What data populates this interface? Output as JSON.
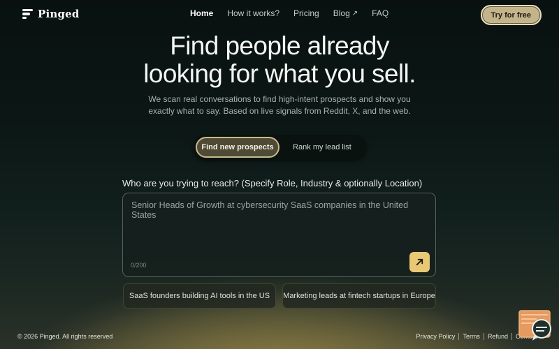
{
  "nav": {
    "brand": "Pinged",
    "links": [
      {
        "label": "Home",
        "active": true
      },
      {
        "label": "How it works?",
        "active": false
      },
      {
        "label": "Pricing",
        "active": false
      },
      {
        "label": "Blog",
        "external_icon": "arrow-up-right-icon",
        "active": false
      },
      {
        "label": "FAQ",
        "active": false
      }
    ],
    "cta_label": "Try for free"
  },
  "hero": {
    "title_line1": "Find people already",
    "title_line2": "looking for what you sell.",
    "subtitle_line1": "We scan real conversations to find high-intent prospects and show you",
    "subtitle_line2": "exactly what to say. Based on live signals from Reddit, X, and the web."
  },
  "mode_toggle": {
    "options": [
      "Find new prospects",
      "Rank my lead list"
    ],
    "selected": "Find new prospects"
  },
  "prompt": {
    "label": "Who are you trying to reach? (Specify Role, Industry & optionally Location)",
    "placeholder": "Senior Heads of Growth at cybersecurity SaaS companies in the United States",
    "value": "",
    "counter": "0/200",
    "submit_icon": "arrow-up-right-icon"
  },
  "suggestions": [
    "SaaS founders building AI tools in the US",
    "Marketing leads at fintech startups in Europe"
  ],
  "footer": {
    "copyright": "© 2026 Pinged. All rights reserved",
    "links": [
      "Privacy Policy",
      "Terms",
      "Refund",
      "Contact"
    ]
  },
  "colors": {
    "accent": "#e8c870",
    "cta_bg": "#c3b48a",
    "background_top": "#08110f"
  },
  "icons": {
    "brand": "pinged-logo-icon",
    "chat_widget": "chat-support-icon"
  }
}
